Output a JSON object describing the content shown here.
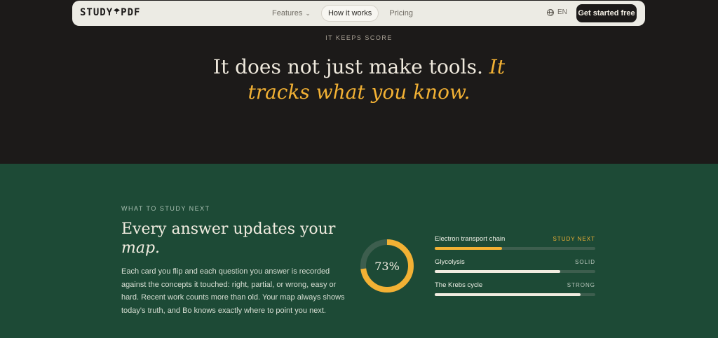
{
  "nav": {
    "logo": "STUDYPDF",
    "links": [
      {
        "label": "Features",
        "has_dropdown": true,
        "active": false
      },
      {
        "label": "How it works",
        "active": true
      },
      {
        "label": "Pricing",
        "active": false
      }
    ],
    "language": "EN",
    "cta": "Get started free",
    "icons": {
      "language": "globe-icon",
      "dropdown": "chevron-down-icon",
      "logo_cap": "graduation-cap-icon"
    }
  },
  "hero": {
    "eyebrow": "IT KEEPS SCORE",
    "headline_plain": "It does not just make tools.",
    "headline_accent": "It tracks what you know."
  },
  "study": {
    "eyebrow": "WHAT TO STUDY NEXT",
    "title_plain": "Every answer updates your",
    "title_italic": "map.",
    "body": "Each card you flip and each question you answer is recorded against the concepts it touched: right, partial, or wrong, easy or hard. Recent work counts more than old. Your map always shows today's truth, and Bo knows exactly where to point you next.",
    "mastery": {
      "value": 0.73,
      "label": "73%"
    },
    "concepts": [
      {
        "name": "Electron transport chain",
        "status": "STUDY NEXT",
        "level": 0.42,
        "highlight": true
      },
      {
        "name": "Glycolysis",
        "status": "SOLID",
        "level": 0.78,
        "highlight": false
      },
      {
        "name": "The Krebs cycle",
        "status": "STRONG",
        "level": 0.91,
        "highlight": false
      }
    ]
  },
  "colors": {
    "dark_bg": "#1c1a19",
    "green_bg": "#1d4a36",
    "accent": "#f2b134",
    "nav_bg": "#ecebe4",
    "cream": "#f1ece0"
  }
}
